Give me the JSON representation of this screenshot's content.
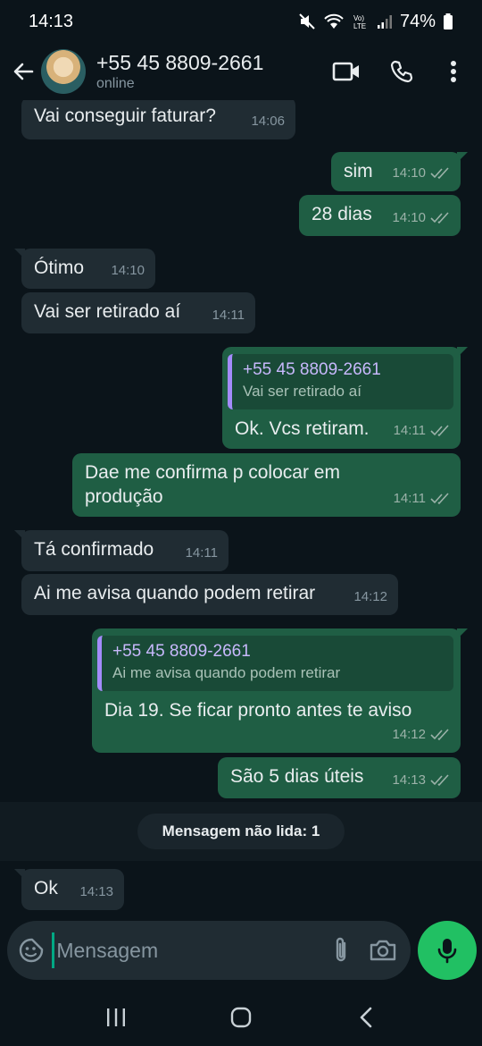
{
  "status_bar": {
    "time": "14:13",
    "battery": "74%",
    "network": "LTE"
  },
  "header": {
    "contact_name": "+55 45 8809-2661",
    "status": "online"
  },
  "messages": [
    {
      "dir": "in",
      "text": "Vai conseguir faturar?",
      "time": "14:06"
    },
    {
      "dir": "out",
      "text": "sim",
      "time": "14:10"
    },
    {
      "dir": "out",
      "text": "28 dias",
      "time": "14:10"
    },
    {
      "dir": "in",
      "text": "Ótimo",
      "time": "14:10"
    },
    {
      "dir": "in",
      "text": "Vai ser retirado aí",
      "time": "14:11"
    },
    {
      "dir": "out",
      "quote_name": "+55 45 8809-2661",
      "quote_text": "Vai ser retirado aí",
      "text": "Ok. Vcs retiram.",
      "time": "14:11"
    },
    {
      "dir": "out",
      "text": "Dae me confirma p colocar em produção",
      "time": "14:11"
    },
    {
      "dir": "in",
      "text": "Tá confirmado",
      "time": "14:11"
    },
    {
      "dir": "in",
      "text": "Ai me avisa quando podem retirar",
      "time": "14:12"
    },
    {
      "dir": "out",
      "quote_name": "+55 45 8809-2661",
      "quote_text": "Ai me avisa quando podem retirar",
      "text": "Dia 19.  Se ficar  pronto  antes te aviso",
      "time": "14:12"
    },
    {
      "dir": "out",
      "text": "São  5 dias úteis",
      "time": "14:13"
    },
    {
      "dir": "in",
      "text": "Ok",
      "time": "14:13"
    }
  ],
  "unread_label": "Mensagem não lida: 1",
  "composer": {
    "placeholder": "Mensagem"
  },
  "colors": {
    "background": "#0b141a",
    "incoming": "#202c33",
    "outgoing": "#1f5e44",
    "accent": "#21c063",
    "quote_bar": "#a38bfa"
  },
  "icons": [
    "back-arrow-icon",
    "video-call-icon",
    "phone-icon",
    "more-vert-icon",
    "sticker-icon",
    "attach-icon",
    "camera-icon",
    "mic-icon"
  ]
}
